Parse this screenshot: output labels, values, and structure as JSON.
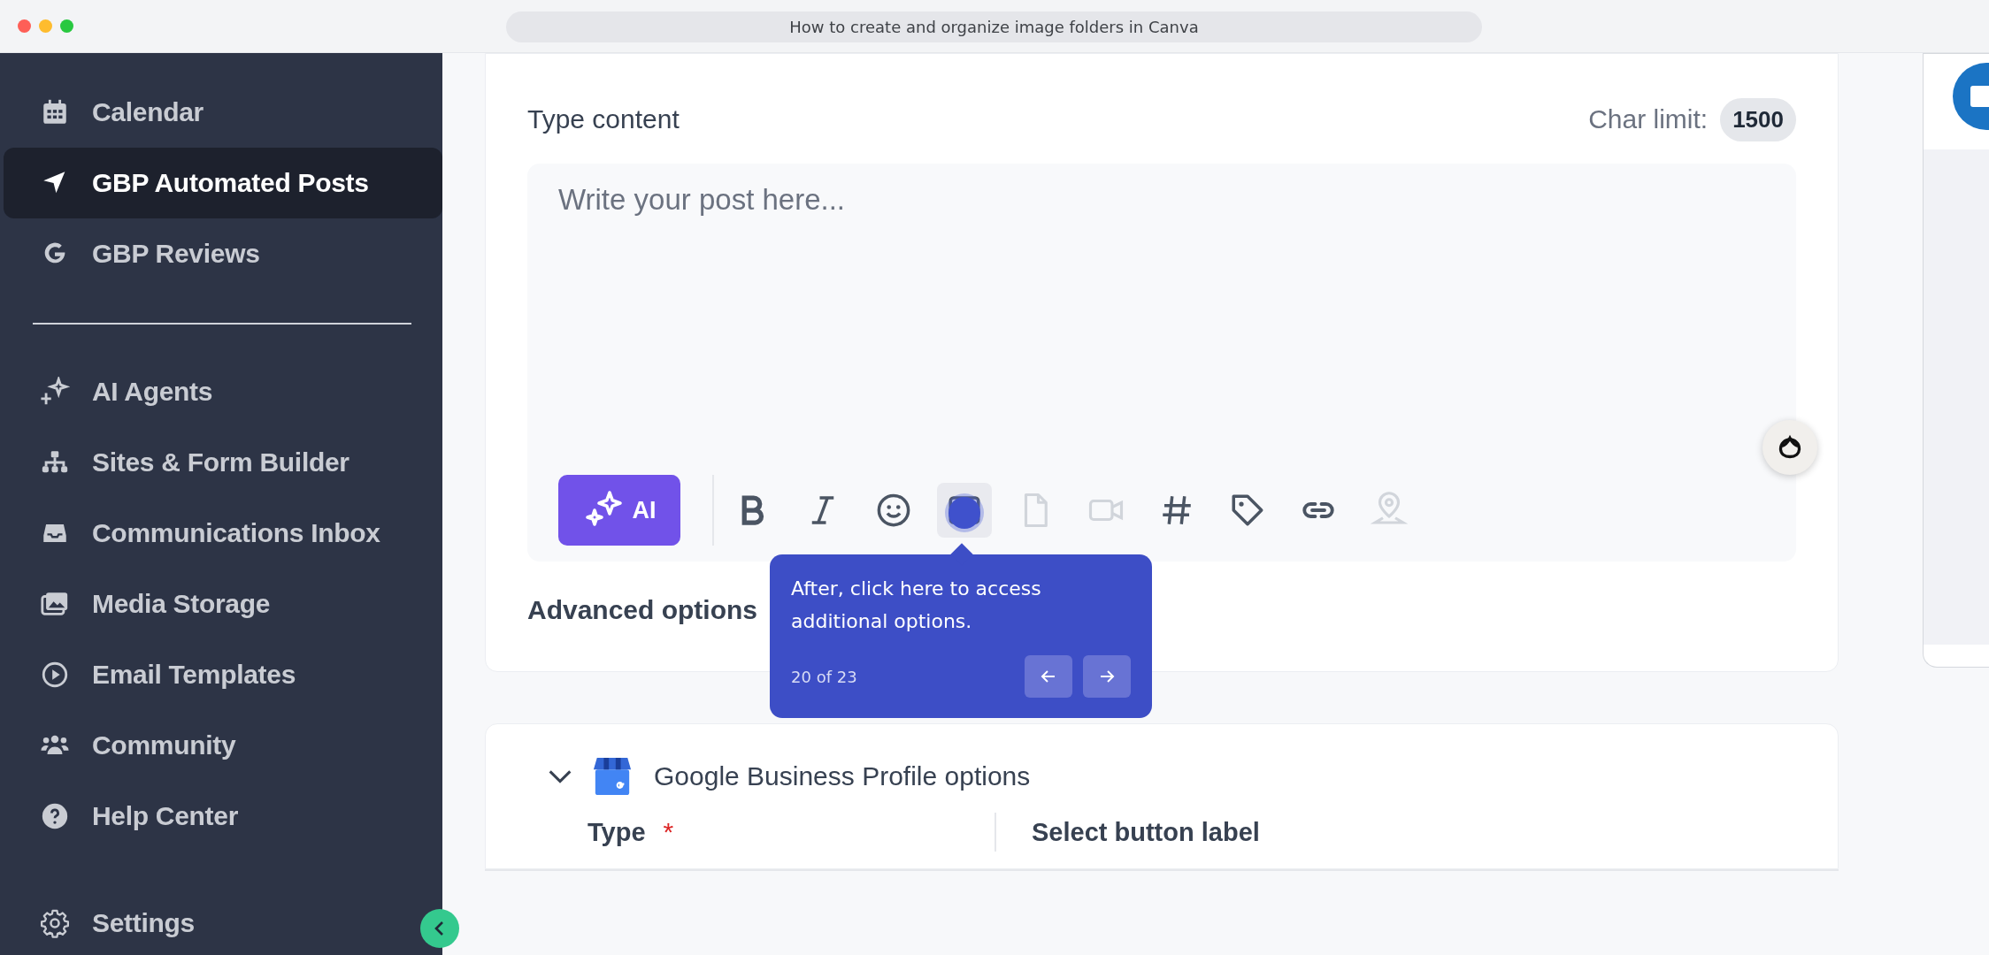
{
  "window": {
    "title": "How to create and organize image folders in Canva"
  },
  "sidebar": {
    "groups": [
      [
        {
          "label": "Calendar",
          "selected": false
        },
        {
          "label": "GBP Automated Posts",
          "selected": true
        },
        {
          "label": "GBP Reviews",
          "selected": false
        }
      ],
      [
        {
          "label": "AI Agents",
          "selected": false
        },
        {
          "label": "Sites & Form Builder",
          "selected": false
        },
        {
          "label": "Communications Inbox",
          "selected": false
        },
        {
          "label": "Media Storage",
          "selected": false
        },
        {
          "label": "Email Templates",
          "selected": false
        },
        {
          "label": "Community",
          "selected": false
        },
        {
          "label": "Help Center",
          "selected": false
        }
      ]
    ],
    "footer_item": {
      "label": "Settings",
      "selected": false
    }
  },
  "composer": {
    "label": "Type content",
    "char_limit_label": "Char limit:",
    "char_limit": "1500",
    "placeholder": "Write your post here...",
    "ai_button": "AI",
    "tools": [
      {
        "disabled": false,
        "selected": false
      },
      {
        "disabled": false,
        "selected": false
      },
      {
        "disabled": false,
        "selected": false
      },
      {
        "disabled": false,
        "selected": true
      },
      {
        "disabled": true,
        "selected": false
      },
      {
        "disabled": true,
        "selected": false
      },
      {
        "disabled": false,
        "selected": false
      },
      {
        "disabled": false,
        "selected": false
      },
      {
        "disabled": false,
        "selected": false
      },
      {
        "disabled": true,
        "selected": false
      }
    ],
    "advanced": "Advanced options"
  },
  "tooltip": {
    "text": "After, click here to access additional options.",
    "step": "20 of 23"
  },
  "gbp_section": {
    "title": "Google Business Profile options",
    "expanded": true,
    "fields": [
      {
        "label": "Type",
        "required_mark": "*"
      },
      {
        "label": "Select button label"
      }
    ]
  }
}
